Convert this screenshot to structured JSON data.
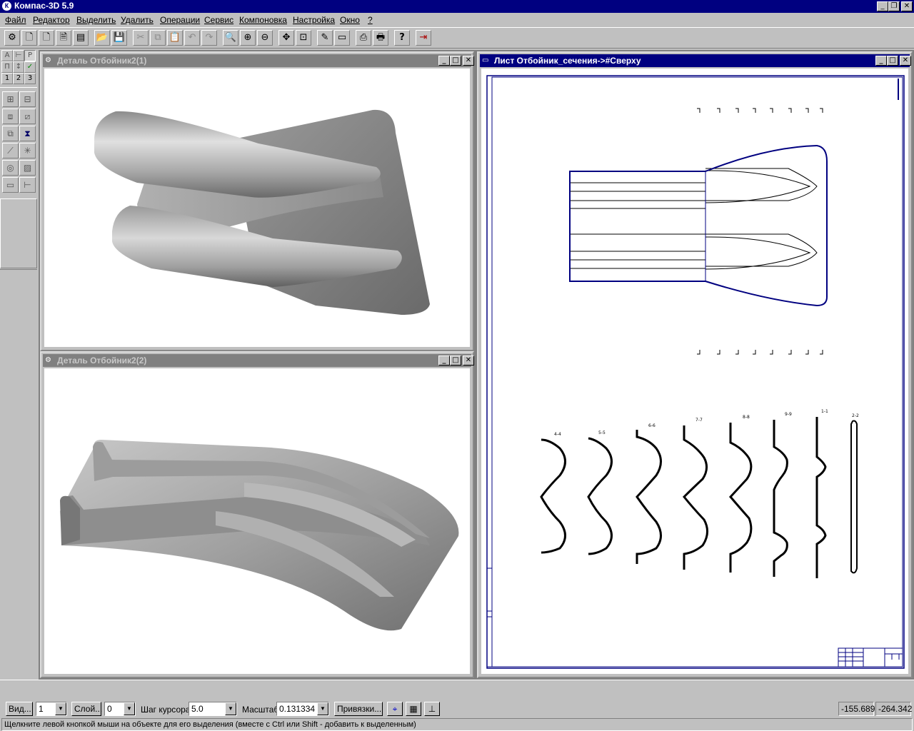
{
  "app": {
    "title": "Компас-3D 5.9",
    "icon": "kompas-logo-icon"
  },
  "menu": [
    {
      "label": "Файл"
    },
    {
      "label": "Редактор"
    },
    {
      "label": "Выделить"
    },
    {
      "label": "Удалить"
    },
    {
      "label": "Операции"
    },
    {
      "label": "Сервис"
    },
    {
      "label": "Компоновка"
    },
    {
      "label": "Настройка"
    },
    {
      "label": "Окно"
    },
    {
      "label": "?"
    }
  ],
  "toolbar": {
    "buttons": [
      {
        "name": "model-icon",
        "glyph": "⚙"
      },
      {
        "name": "new-document-icon",
        "glyph": "🗋"
      },
      {
        "name": "new-sheet-icon",
        "glyph": "🗋"
      },
      {
        "name": "new-fragment-icon",
        "glyph": "🗎"
      },
      {
        "name": "new-spec-icon",
        "glyph": "▤"
      },
      {
        "name": "open-icon",
        "glyph": "📂"
      },
      {
        "name": "save-icon",
        "glyph": "💾"
      },
      {
        "name": "cut-icon",
        "glyph": "✂"
      },
      {
        "name": "copy-icon",
        "glyph": "⧉"
      },
      {
        "name": "paste-icon",
        "glyph": "📋"
      },
      {
        "name": "undo-icon",
        "glyph": "↶"
      },
      {
        "name": "redo-icon",
        "glyph": "↷"
      },
      {
        "name": "zoom-icon",
        "glyph": "🔍"
      },
      {
        "name": "zoom-in-icon",
        "glyph": "⊕"
      },
      {
        "name": "zoom-out-icon",
        "glyph": "⊖"
      },
      {
        "name": "pan-icon",
        "glyph": "✥"
      },
      {
        "name": "zoom-all-icon",
        "glyph": "⊡"
      },
      {
        "name": "edit-icon",
        "glyph": "✎"
      },
      {
        "name": "regenerate-icon",
        "glyph": "▭"
      },
      {
        "name": "preview-icon",
        "glyph": "⎙"
      },
      {
        "name": "print-icon",
        "glyph": "🖶"
      },
      {
        "name": "help-pointer-icon",
        "glyph": "?"
      },
      {
        "name": "exit-icon",
        "glyph": "⇥"
      }
    ]
  },
  "palette": {
    "top_row1": [
      "А",
      "⊢",
      "Р"
    ],
    "top_row2": [
      "П",
      "↕",
      "✓"
    ],
    "top_row3": [
      "1",
      "2",
      "3"
    ]
  },
  "windows": {
    "part1": {
      "title": "Деталь Отбойник2(1)",
      "icon": "part-icon"
    },
    "part2": {
      "title": "Деталь Отбойник2(2)",
      "icon": "part-icon"
    },
    "sheet": {
      "title": "Лист Отбойник_сечения->#Сверху",
      "icon": "sheet-icon"
    }
  },
  "propbar": {
    "view_button": "Вид...",
    "view_value": "1",
    "layer_button": "Слой...",
    "layer_value": "0",
    "step_label": "Шаг курсора",
    "step_value": "5.0",
    "scale_label": "Масштаб",
    "scale_value": "0.131334",
    "snaps_button": "Привязки...",
    "coord_x": "-155.689",
    "coord_y": "-264.342"
  },
  "status": {
    "text": "Щелкните левой кнопкой мыши на объекте для его выделения (вместе с Ctrl или Shift - добавить к выделенным)"
  }
}
